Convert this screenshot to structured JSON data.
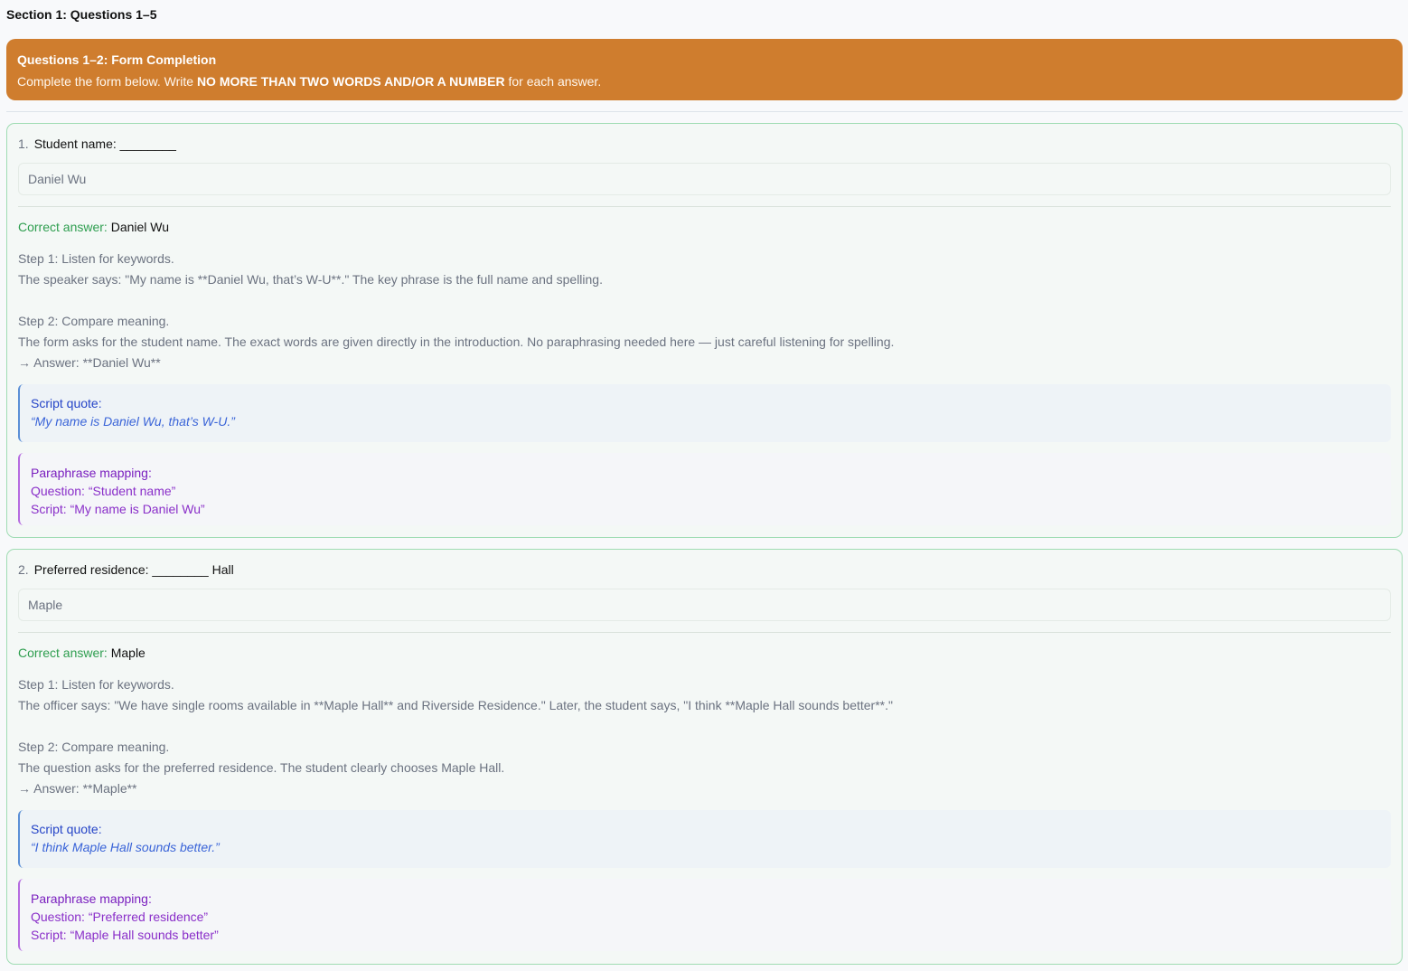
{
  "section": {
    "title": "Section 1: Questions 1–5"
  },
  "instructions": {
    "title": "Questions 1–2: Form Completion",
    "text_before": "Complete the form below. Write ",
    "text_bold": "NO MORE THAN TWO WORDS AND/OR A NUMBER",
    "text_after": " for each answer."
  },
  "questions": [
    {
      "number": "1.",
      "prompt": "Student name: ________",
      "input_value": "Daniel Wu",
      "correct_label": "Correct answer:",
      "correct_value": "Daniel Wu",
      "step1_title": "Step 1: Listen for keywords.",
      "step1_text": "The speaker says: \"My name is **Daniel Wu, that’s W-U**.\" The key phrase is the full name and spelling.",
      "step2_title": "Step 2: Compare meaning.",
      "step2_text": "The form asks for the student name. The exact words are given directly in the introduction. No paraphrasing needed here — just careful listening for spelling.",
      "answer_line": "→ Answer: **Daniel Wu**",
      "quote_label": "Script quote:",
      "quote_text": "“My name is Daniel Wu, that’s W-U.”",
      "mapping_label": "Paraphrase mapping:",
      "mapping_question": "Question: “Student name”",
      "mapping_script": "Script: “My name is Daniel Wu”"
    },
    {
      "number": "2.",
      "prompt": "Preferred residence: ________ Hall",
      "input_value": "Maple",
      "correct_label": "Correct answer:",
      "correct_value": "Maple",
      "step1_title": "Step 1: Listen for keywords.",
      "step1_text": "The officer says: \"We have single rooms available in **Maple Hall** and Riverside Residence.\" Later, the student says, \"I think **Maple Hall sounds better**.\"",
      "step2_title": "Step 2: Compare meaning.",
      "step2_text": "The question asks for the preferred residence. The student clearly chooses Maple Hall.",
      "answer_line": "→ Answer: **Maple**",
      "quote_label": "Script quote:",
      "quote_text": "“I think Maple Hall sounds better.”",
      "mapping_label": "Paraphrase mapping:",
      "mapping_question": "Question: “Preferred residence”",
      "mapping_script": "Script: “Maple Hall sounds better”"
    }
  ],
  "colors": {
    "instruction_banner": "#cf7d2e",
    "card_border": "#9fdcb3",
    "correct_label": "#2e9e4f",
    "quote_accent": "#3a64d8",
    "mapping_accent": "#8a2fc9"
  }
}
